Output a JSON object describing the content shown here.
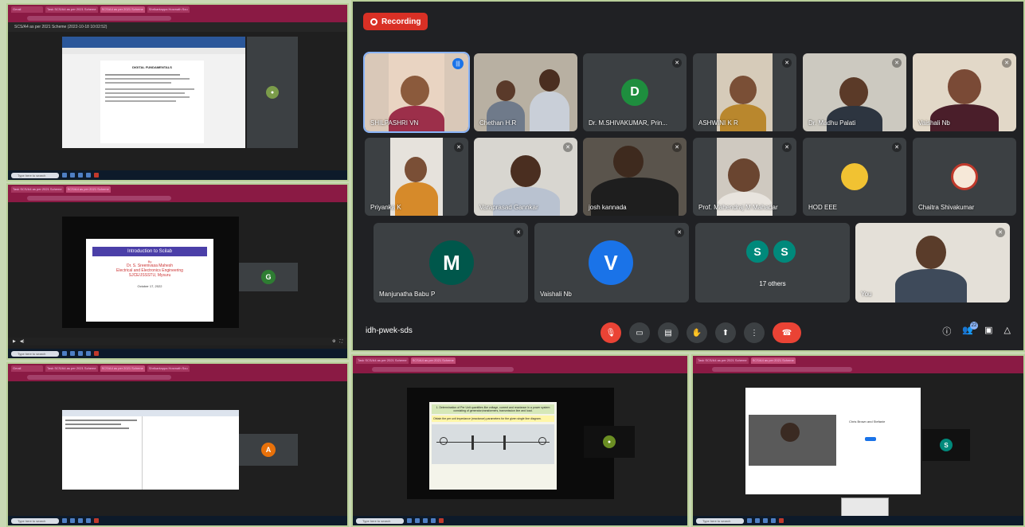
{
  "panels": {
    "p1": {
      "tabs": [
        "Gmail",
        "Task SCS/A4 as per 2021 Scheme",
        "SCS/A4 as per 2021 Scheme",
        "Shrikantappa Hosmath Scu"
      ],
      "docbar": "SCS/A4 as per 2021 Scheme (2022-10-18 10:02:52)",
      "doc_title": "DIGITAL FUNDAMENTALS",
      "taskbar_search": "Type here to search"
    },
    "p2": {
      "tabs": [
        "Task SCS/A4 as per 2021 Scheme",
        "SCS/A4 as per 2021 Scheme"
      ],
      "slide_title": "Introduction to Scilab",
      "slide_by": "By",
      "slide_author": "Dr. S. Sreenivasa Mahesh",
      "slide_dept": "Electrical and Electronics Engineering",
      "slide_inst": "SJCE/JSSSTU, Mysuru",
      "slide_date": "October 17, 2022",
      "participant_initial": "G",
      "taskbar_search": "Type here to search"
    },
    "p3": {
      "tabs": [
        "Gmail",
        "Task SCS/A4 as per 2021 Scheme",
        "SCS/A4 as per 2021 Scheme",
        "Shrikantappa Hosmath Scu"
      ],
      "participant_initial": "A",
      "taskbar_search": "Type here to search"
    },
    "p4": {
      "tabs": [
        "Task SCS/A4 as per 2021 Scheme",
        "SCS/A4 as per 2021 Scheme"
      ],
      "slide_line1": "1. Determination of Per Unit quantities like voltage, current and reactance in a power system consisting of generator,transformers, transmission line and load.",
      "slide_line2": "Obtain the per unit impedance (reactance) parameters for the given single line diagram.",
      "taskbar_search": "Type here to search"
    },
    "p5": {
      "tabs": [
        "Task SCS/A4 as per 2021 Scheme",
        "SCS/A4 as per 2021 Scheme"
      ],
      "inner_title": "Chris Brown and Stefanie",
      "participant_initial": "S",
      "taskbar_search": "Type here to search"
    }
  },
  "meet": {
    "recording_label": "Recording",
    "meeting_code": "idh-pwek-sds",
    "others_count": "17 others",
    "raise_count": "22",
    "tiles": [
      {
        "name": "SHILPASHRI VN",
        "type": "photo",
        "speaking": true
      },
      {
        "name": "Chethan H.R",
        "type": "photo"
      },
      {
        "name": "Dr. M.SHIVAKUMAR, Prin...",
        "type": "avatar",
        "initial": "D",
        "color": "#1e8e3e"
      },
      {
        "name": "ASHWINI K R",
        "type": "photo"
      },
      {
        "name": "Dr. Madhu Palati",
        "type": "photo"
      },
      {
        "name": "Vaishali Nb",
        "type": "photo"
      },
      {
        "name": "Priyanka K",
        "type": "photo"
      },
      {
        "name": "Varaprasad Gannkar",
        "type": "photo"
      },
      {
        "name": "josh kannada",
        "type": "photo"
      },
      {
        "name": "Prof. Mahendraj M Mahadar",
        "type": "photo"
      },
      {
        "name": "HOD EEE",
        "type": "smallavatar"
      },
      {
        "name": "Chaitra Shivakumar",
        "type": "smallavatar"
      },
      {
        "name": "Manjunatha Babu P",
        "type": "avatar",
        "initial": "M",
        "color": "#00574b"
      },
      {
        "name": "Vaishali Nb",
        "type": "avatar",
        "initial": "V",
        "color": "#1a73e8"
      },
      {
        "name": "",
        "type": "others",
        "initials": [
          "S",
          "S"
        ]
      },
      {
        "name": "You",
        "type": "photo"
      }
    ]
  },
  "colors": {
    "browser_chrome": "#8a1a44",
    "meet_bg": "#202124",
    "tile_bg": "#3c4043",
    "rec_red": "#d93025",
    "border": "#b9cf9a"
  }
}
